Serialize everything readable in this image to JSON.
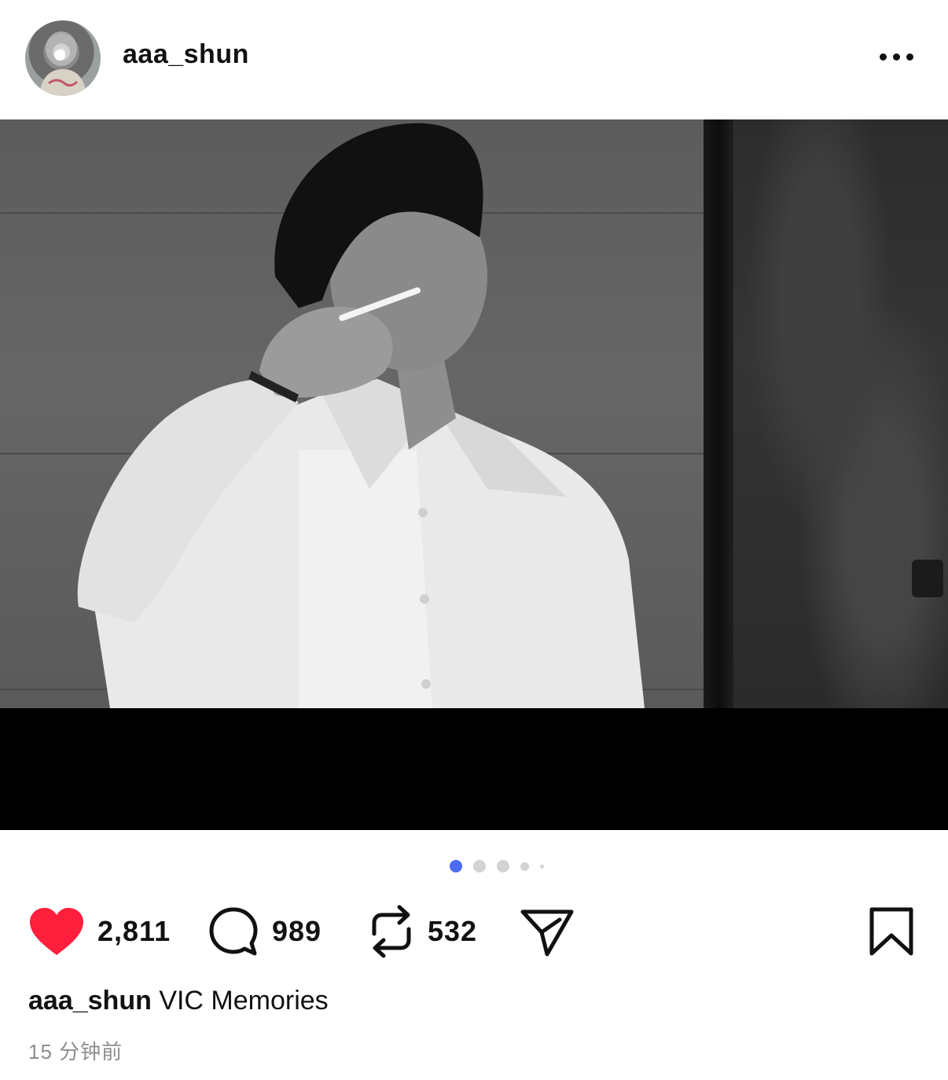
{
  "post": {
    "username": "aaa_shun",
    "caption_user": "aaa_shun",
    "caption_text": "VIC Memories",
    "timestamp": "15 分钟前",
    "likes": "2,811",
    "comments": "989",
    "reposts": "532",
    "liked": true,
    "carousel": {
      "current": 1,
      "total": 5
    }
  },
  "icons": {
    "like": "heart-filled-icon",
    "comment": "comment-bubble-icon",
    "repost": "repost-arrows-icon",
    "share": "send-paper-plane-icon",
    "save": "bookmark-icon",
    "more": "more-horizontal-icon"
  },
  "colors": {
    "like": "#ff1f3d",
    "pager_active": "#4b6cf0",
    "pager_inactive": "#d3d3d3",
    "timestamp": "#8e8e8e"
  }
}
